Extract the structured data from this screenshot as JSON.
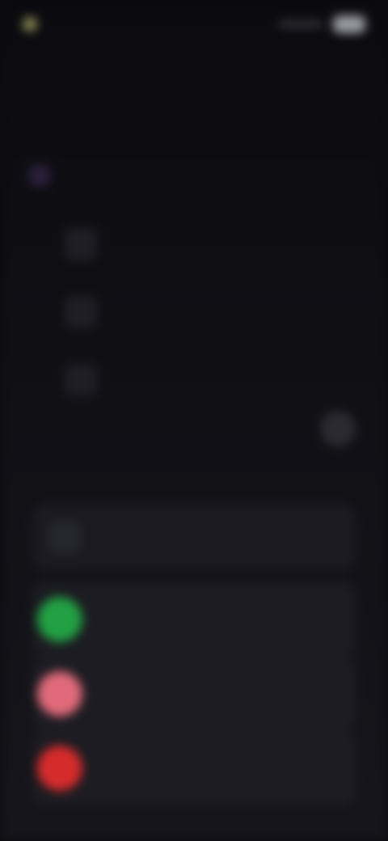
{
  "status_bar": {
    "time": "",
    "indicator_color": "#8a8a55"
  },
  "header": {
    "title": "",
    "subtitle": ""
  },
  "tab": {
    "label": "",
    "accent": "#5a2a6a"
  },
  "options": [
    {
      "label": "",
      "value": ""
    },
    {
      "label": "",
      "value": ""
    },
    {
      "label": "",
      "value": ""
    }
  ],
  "option_caption": "",
  "section": {
    "title": "",
    "top_card_label": ""
  },
  "apps": [
    {
      "label": "",
      "color": "#22a043"
    },
    {
      "label": "",
      "color": "#e06a7a"
    },
    {
      "label": "",
      "color": "#d62b2b"
    }
  ],
  "icons": {
    "status": "circle-icon",
    "tab": "square-icon",
    "fab": "plus-icon",
    "chevron": "chevron-right-icon"
  }
}
